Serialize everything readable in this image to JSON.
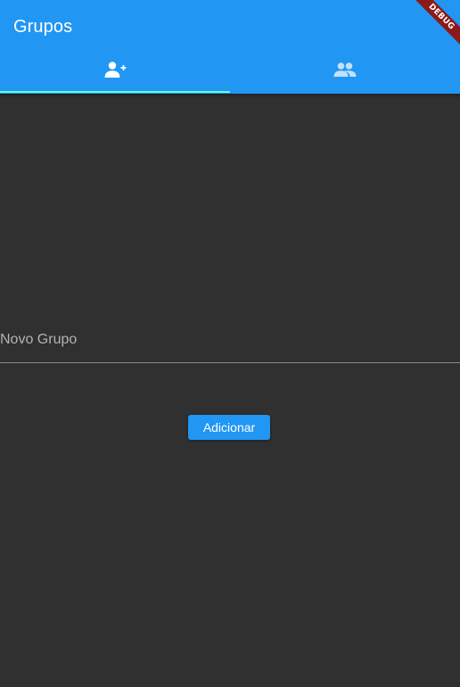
{
  "app": {
    "title": "Grupos",
    "debug_label": "DEBUG"
  },
  "tabs": [
    {
      "icon": "person-add-icon",
      "active": true
    },
    {
      "icon": "group-icon",
      "active": false
    }
  ],
  "form": {
    "group_name_placeholder": "Novo Grupo",
    "group_name_value": "",
    "add_button_label": "Adicionar"
  },
  "colors": {
    "primary": "#2196F3",
    "accent": "#64FFDA",
    "background": "#303030",
    "debug_banner": "#8B1A1A"
  }
}
